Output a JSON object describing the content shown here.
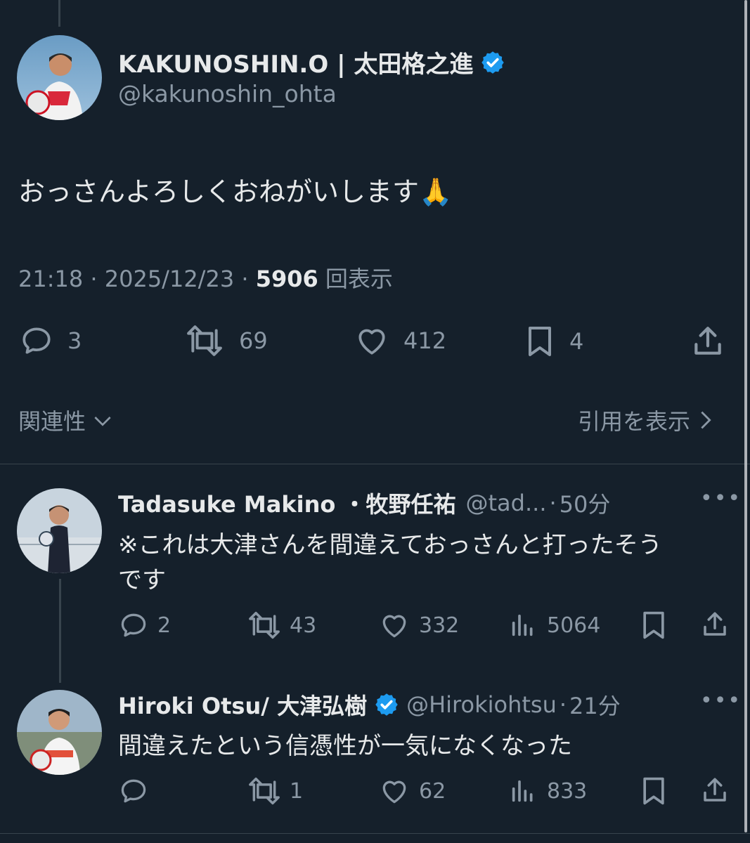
{
  "main_tweet": {
    "author_name": "KAKUNOSHIN.O | 太田格之進",
    "handle": "@kakunoshin_ohta",
    "text": "おっさんよろしくおねがいします🙏",
    "time": "21:18",
    "date": "2025/12/23",
    "views_count": "5906",
    "views_label": "回表示",
    "replies": "3",
    "retweets": "69",
    "likes": "412",
    "bookmarks": "4"
  },
  "sort": {
    "label": "関連性",
    "quotes_label": "引用を表示"
  },
  "replies": [
    {
      "author_name": "Tadasuke Makino ・牧野任祐",
      "handle": "@tad...",
      "time": "50分",
      "text_line1": "※これは大津さんを間違えておっさんと打ったそう",
      "text_line2": "です",
      "replies": "2",
      "retweets": "43",
      "likes": "332",
      "views": "5064"
    },
    {
      "author_name": "Hiroki Otsu/ 大津弘樹",
      "handle": "@Hirokiohtsu",
      "time": "21分",
      "text_line1": "間違えたという信憑性が一気になくなった",
      "retweets": "1",
      "likes": "62",
      "views": "833"
    }
  ],
  "colors": {
    "background": "#15202b",
    "verified": "#1d9bf0",
    "muted": "#8b98a5",
    "divider": "#38444d"
  },
  "icons": [
    "reply-icon",
    "retweet-icon",
    "like-icon",
    "bookmark-icon",
    "share-icon",
    "views-icon",
    "verified-badge-icon",
    "more-icon",
    "chevron-down-icon",
    "chevron-right-icon"
  ]
}
